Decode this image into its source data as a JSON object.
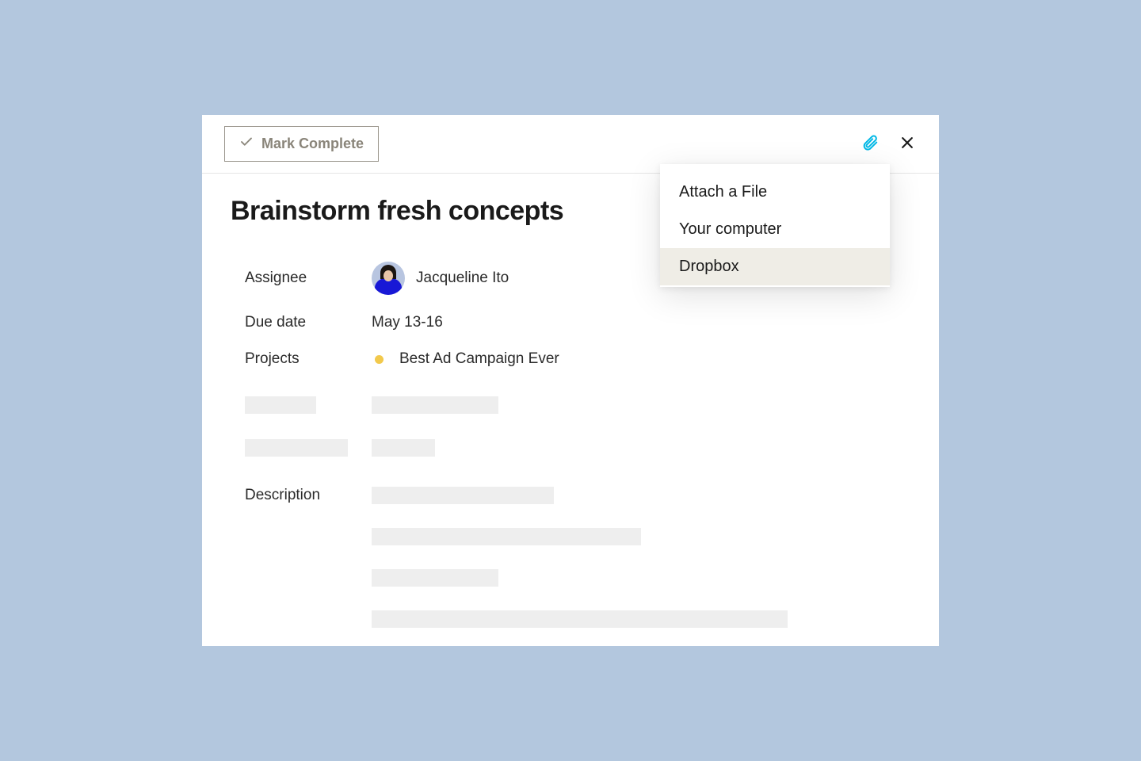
{
  "header": {
    "mark_complete_label": "Mark Complete"
  },
  "task": {
    "title": "Brainstorm fresh concepts",
    "fields": {
      "assignee_label": "Assignee",
      "assignee_name": "Jacqueline Ito",
      "due_date_label": "Due date",
      "due_date_value": "May 13-16",
      "projects_label": "Projects",
      "project_name": "Best Ad Campaign Ever",
      "description_label": "Description"
    }
  },
  "attach_menu": {
    "title": "Attach a File",
    "items": [
      {
        "label": "Your computer",
        "highlighted": false
      },
      {
        "label": "Dropbox",
        "highlighted": true
      }
    ]
  },
  "colors": {
    "accent_attach": "#00b8e6",
    "project_dot": "#f2c94c"
  }
}
